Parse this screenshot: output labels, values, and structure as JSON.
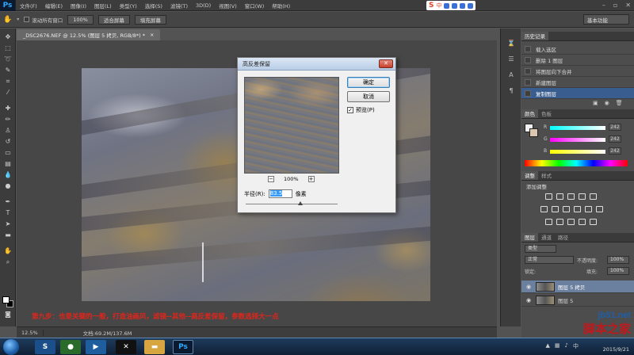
{
  "app": {
    "logo": "Ps"
  },
  "menu": [
    "文件(F)",
    "编辑(E)",
    "图像(I)",
    "图层(L)",
    "类型(Y)",
    "选择(S)",
    "滤镜(T)",
    "3D(D)",
    "视图(V)",
    "窗口(W)",
    "帮助(H)"
  ],
  "ime": {
    "logo": "S",
    "mode": "中"
  },
  "options": {
    "scroll_all_label": "滚动所有窗口",
    "zoom_100": "100%",
    "fit_screen": "适合屏幕",
    "fill_screen": "填充屏幕",
    "workspace": "基本功能"
  },
  "document": {
    "tab_title": "_DSC2676.NEF @ 12.5% (图层 5 拷贝, RGB/8*) *",
    "zoom": "12.5%",
    "doc_size": "文档:69.2M/137.6M"
  },
  "caption": "第九步：也是关键的一般，打造油画风，滤镜--其他--高反差保留，参数选择大一点",
  "dialog": {
    "title": "高反差保留",
    "ok_label": "确定",
    "cancel_label": "取消",
    "preview_label": "预览(P)",
    "preview_checked": true,
    "zoom_percent": "100%",
    "radius_label": "半径(R):",
    "radius_value": "83.5",
    "radius_unit": "像素"
  },
  "history": {
    "tab": "历史记录",
    "items": [
      "载入选区",
      "删除 1 图层",
      "将图层向下合并",
      "新建图层",
      "复制图层"
    ],
    "selected_index": 4
  },
  "color": {
    "tabs": [
      "颜色",
      "色板"
    ],
    "channels": [
      {
        "label": "R",
        "value": "242"
      },
      {
        "label": "G",
        "value": "242"
      },
      {
        "label": "B",
        "value": "242"
      }
    ]
  },
  "adjustments": {
    "tabs": [
      "调整",
      "样式"
    ],
    "title": "添加调整"
  },
  "layers": {
    "tabs": [
      "图层",
      "通道",
      "路径"
    ],
    "kind_filter": "类型",
    "blend_mode": "正常",
    "opacity_label": "不透明度:",
    "opacity_value": "100%",
    "lock_label": "锁定:",
    "fill_label": "填充:",
    "fill_value": "100%",
    "items": [
      "图层 5 拷贝",
      "图层 5"
    ],
    "selected_index": 0
  },
  "taskbar": {
    "clock_time": "",
    "clock_date": "2015/9/21"
  },
  "watermark": {
    "site": "jb51.net",
    "name": "脚本之家"
  },
  "colors": {
    "caption": "#e0251b",
    "history_selected": "#3a5d8f",
    "layer_selected": "#6b7f9e"
  }
}
